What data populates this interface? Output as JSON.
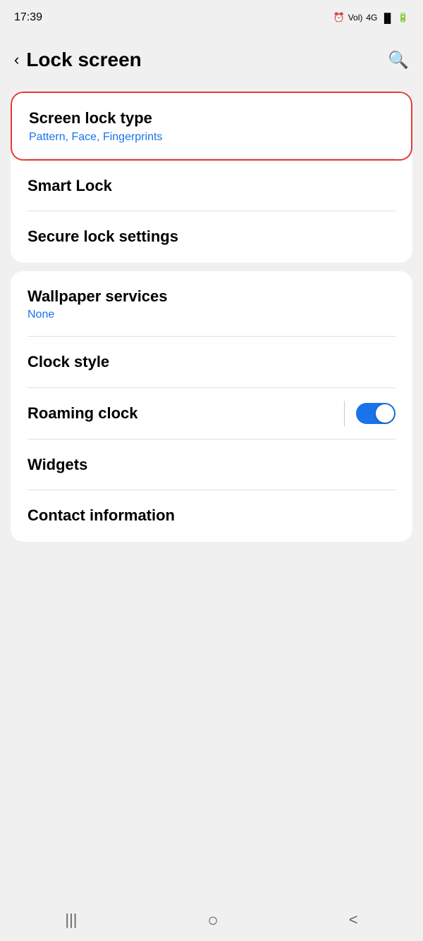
{
  "statusBar": {
    "time": "17:39",
    "icons": "🔔 Vol 4G LTE ▲▼ ▐▌ 🔋"
  },
  "header": {
    "back_label": "‹",
    "title": "Lock screen",
    "search_label": "🔍"
  },
  "sections": {
    "section1": {
      "items": [
        {
          "title": "Screen lock type",
          "subtitle": "Pattern, Face, Fingerprints",
          "highlighted": true
        },
        {
          "title": "Smart Lock",
          "subtitle": "",
          "highlighted": false
        },
        {
          "title": "Secure lock settings",
          "subtitle": "",
          "highlighted": false
        }
      ]
    },
    "section2": {
      "items": [
        {
          "title": "Wallpaper services",
          "subtitle": "None",
          "highlighted": false
        },
        {
          "title": "Clock style",
          "subtitle": "",
          "highlighted": false
        },
        {
          "title": "Roaming clock",
          "subtitle": "",
          "toggle": true,
          "toggle_on": true,
          "highlighted": false
        },
        {
          "title": "Widgets",
          "subtitle": "",
          "highlighted": false
        },
        {
          "title": "Contact information",
          "subtitle": "",
          "highlighted": false,
          "partial": true
        }
      ]
    }
  },
  "bottomNav": {
    "recent_label": "|||",
    "home_label": "○",
    "back_label": "<"
  }
}
